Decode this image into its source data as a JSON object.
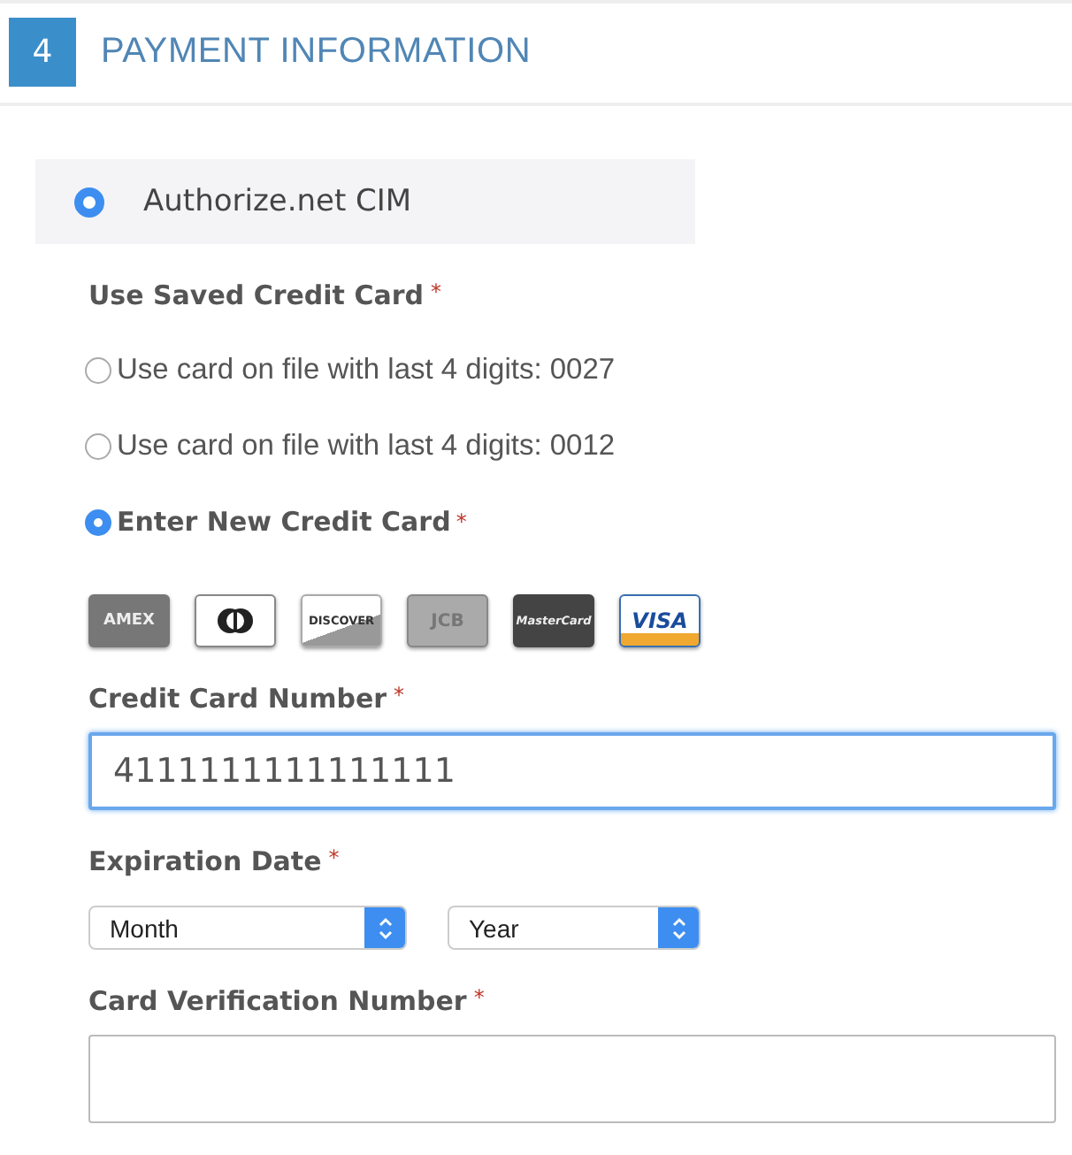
{
  "section": {
    "number": "4",
    "title": "PAYMENT INFORMATION"
  },
  "payment_method": {
    "label": "Authorize.net CIM",
    "selected": true
  },
  "saved_card": {
    "label": "Use Saved Credit Card",
    "required_mark": "*"
  },
  "card_options": [
    {
      "label": "Use card on file with last 4 digits: 0027",
      "selected": false
    },
    {
      "label": "Use card on file with last 4 digits: 0012",
      "selected": false
    },
    {
      "label": "Enter New Credit Card",
      "selected": true,
      "required_mark": "*"
    }
  ],
  "card_types": [
    {
      "kind": "amex",
      "label": "AMEX"
    },
    {
      "kind": "diners"
    },
    {
      "kind": "discover",
      "label": "DISCOVER"
    },
    {
      "kind": "jcb",
      "label": "JCB"
    },
    {
      "kind": "mastercard",
      "label": "MasterCard"
    },
    {
      "kind": "visa",
      "label": "VISA"
    }
  ],
  "card_number": {
    "label": "Credit Card Number",
    "required_mark": "*",
    "value": "4111111111111111",
    "focused": true
  },
  "expiration": {
    "label": "Expiration Date",
    "required_mark": "*",
    "selects": [
      {
        "value": "Month"
      },
      {
        "value": "Year"
      }
    ]
  },
  "cvn": {
    "label": "Card Verification Number",
    "required_mark": "*",
    "focused": false
  }
}
